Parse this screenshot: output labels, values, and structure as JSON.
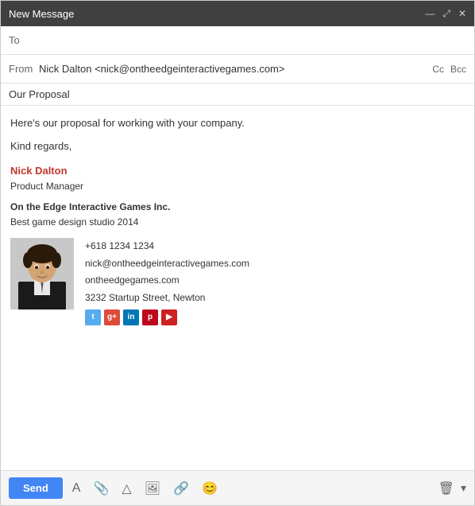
{
  "window": {
    "title": "New Message",
    "controls": {
      "minimize": "—",
      "maximize": "⤢",
      "close": "✕"
    }
  },
  "fields": {
    "to_label": "To",
    "from_label": "From",
    "from_value": "Nick Dalton <nick@ontheedgeinteractivegames.com>",
    "cc_label": "Cc",
    "bcc_label": "Bcc",
    "subject_value": "Our Proposal"
  },
  "body": {
    "line1": "Here's our proposal for working with your company.",
    "line2": "Kind regards,"
  },
  "signature": {
    "name": "Nick Dalton",
    "title": "Product Manager",
    "company": "On the Edge Interactive Games Inc.",
    "tagline": "Best game design studio 2014",
    "phone": "+618 1234 1234",
    "email": "nick@ontheedgeinteractivegames.com",
    "website": "ontheedgegames.com",
    "address": "3232 Startup Street, Newton"
  },
  "social": {
    "twitter": "t",
    "gplus": "g+",
    "linkedin": "in",
    "pinterest": "p",
    "youtube": "▶"
  },
  "toolbar": {
    "send_label": "Send"
  }
}
